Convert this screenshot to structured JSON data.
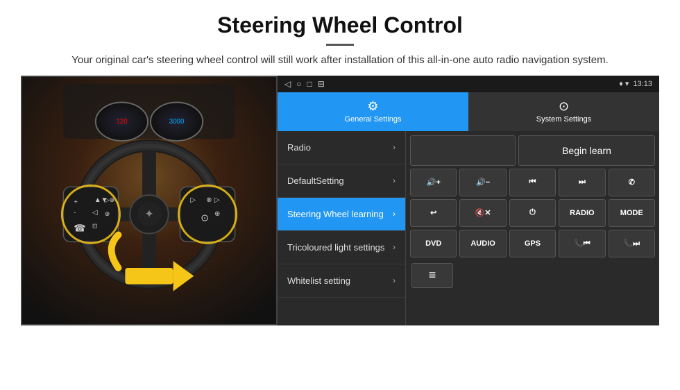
{
  "header": {
    "title": "Steering Wheel Control",
    "subtitle": "Your original car's steering wheel control will still work after installation of this all-in-one auto radio navigation system.",
    "divider": true
  },
  "statusBar": {
    "icons": [
      "◁",
      "○",
      "□",
      "⊟"
    ],
    "rightIcons": "♦ ▾",
    "time": "13:13"
  },
  "tabs": {
    "general": {
      "label": "General Settings",
      "icon": "⚙"
    },
    "system": {
      "label": "System Settings",
      "icon": "⊙"
    }
  },
  "menu": {
    "items": [
      {
        "label": "Radio",
        "active": false
      },
      {
        "label": "DefaultSetting",
        "active": false
      },
      {
        "label": "Steering Wheel learning",
        "active": true
      },
      {
        "label": "Tricoloured light settings",
        "active": false
      },
      {
        "label": "Whitelist setting",
        "active": false
      }
    ]
  },
  "controls": {
    "beginLearn": "Begin learn",
    "row1": [
      {
        "label": "🔊+",
        "type": "vol-up"
      },
      {
        "label": "🔊-",
        "type": "vol-down"
      },
      {
        "label": "⏮",
        "type": "prev"
      },
      {
        "label": "⏭",
        "type": "next"
      },
      {
        "label": "✆",
        "type": "call"
      }
    ],
    "row2": [
      {
        "label": "↩",
        "type": "back"
      },
      {
        "label": "🔇x",
        "type": "mute"
      },
      {
        "label": "⏻",
        "type": "power"
      },
      {
        "label": "RADIO",
        "type": "radio"
      },
      {
        "label": "MODE",
        "type": "mode"
      }
    ],
    "row3": [
      {
        "label": "DVD",
        "type": "dvd"
      },
      {
        "label": "AUDIO",
        "type": "audio"
      },
      {
        "label": "GPS",
        "type": "gps"
      },
      {
        "label": "📞⏮",
        "type": "call-prev"
      },
      {
        "label": "📞⏭",
        "type": "call-next"
      }
    ],
    "whitelistIcon": "≡"
  }
}
